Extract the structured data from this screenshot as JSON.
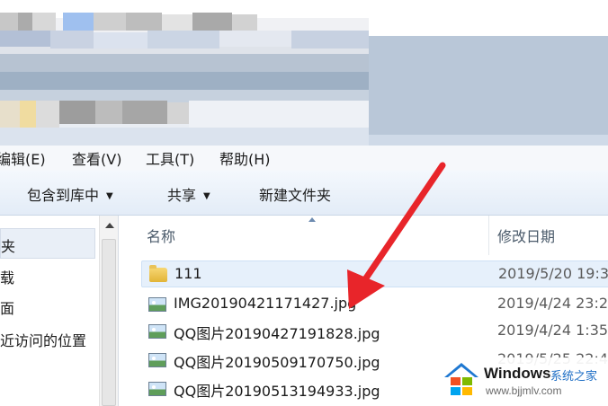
{
  "menu": [
    {
      "label": "编辑(E)"
    },
    {
      "label": "查看(V)"
    },
    {
      "label": "工具(T)"
    },
    {
      "label": "帮助(H)"
    }
  ],
  "toolbar": {
    "include_in_library": "包含到库中",
    "share": "共享",
    "new_folder": "新建文件夹"
  },
  "nav": {
    "items": [
      {
        "label": "夹"
      },
      {
        "label": "载"
      },
      {
        "label": "面"
      },
      {
        "label": "近访问的位置"
      }
    ]
  },
  "columns": {
    "name": "名称",
    "modified": "修改日期"
  },
  "files": [
    {
      "name": "111",
      "date": "2019/5/20 19:3",
      "type": "folder"
    },
    {
      "name": "IMG20190421171427.jpg",
      "date": "2019/4/24 23:2",
      "type": "image"
    },
    {
      "name": "QQ图片20190427191828.jpg",
      "date": "2019/4/24 1:35",
      "type": "image"
    },
    {
      "name": "QQ图片20190509170750.jpg",
      "date": "2019/5/25 22:4",
      "type": "image"
    },
    {
      "name": "QQ图片20190513194933.jpg",
      "date": "",
      "type": "image"
    }
  ],
  "watermark": {
    "brand": "Windows",
    "suffix": "系统之家",
    "url": "www.bjjmlv.com"
  },
  "colors": {
    "annotation_arrow": "#e8252a",
    "toolbar_bg": "#e9f0f9",
    "selection": "#e6f0fb"
  }
}
